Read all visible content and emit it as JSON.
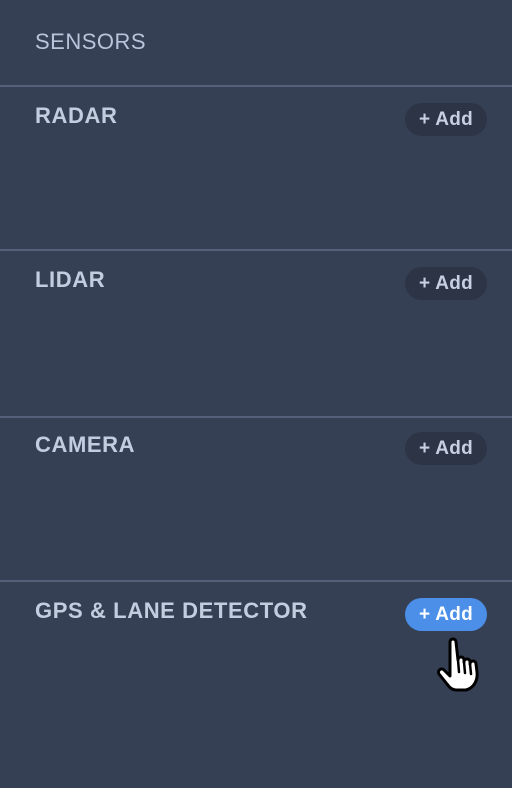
{
  "panel": {
    "title": "SENSORS"
  },
  "sections": [
    {
      "title": "RADAR",
      "add_label": "+ Add"
    },
    {
      "title": "LIDAR",
      "add_label": "+ Add"
    },
    {
      "title": "CAMERA",
      "add_label": "+ Add"
    },
    {
      "title": "GPS & LANE DETECTOR",
      "add_label": "+ Add"
    }
  ],
  "colors": {
    "background": "#364055",
    "divider": "#56607a",
    "button_default": "#2c3445",
    "button_active": "#4b8fe8"
  },
  "icons": {
    "cursor": "hand-pointer-icon"
  }
}
